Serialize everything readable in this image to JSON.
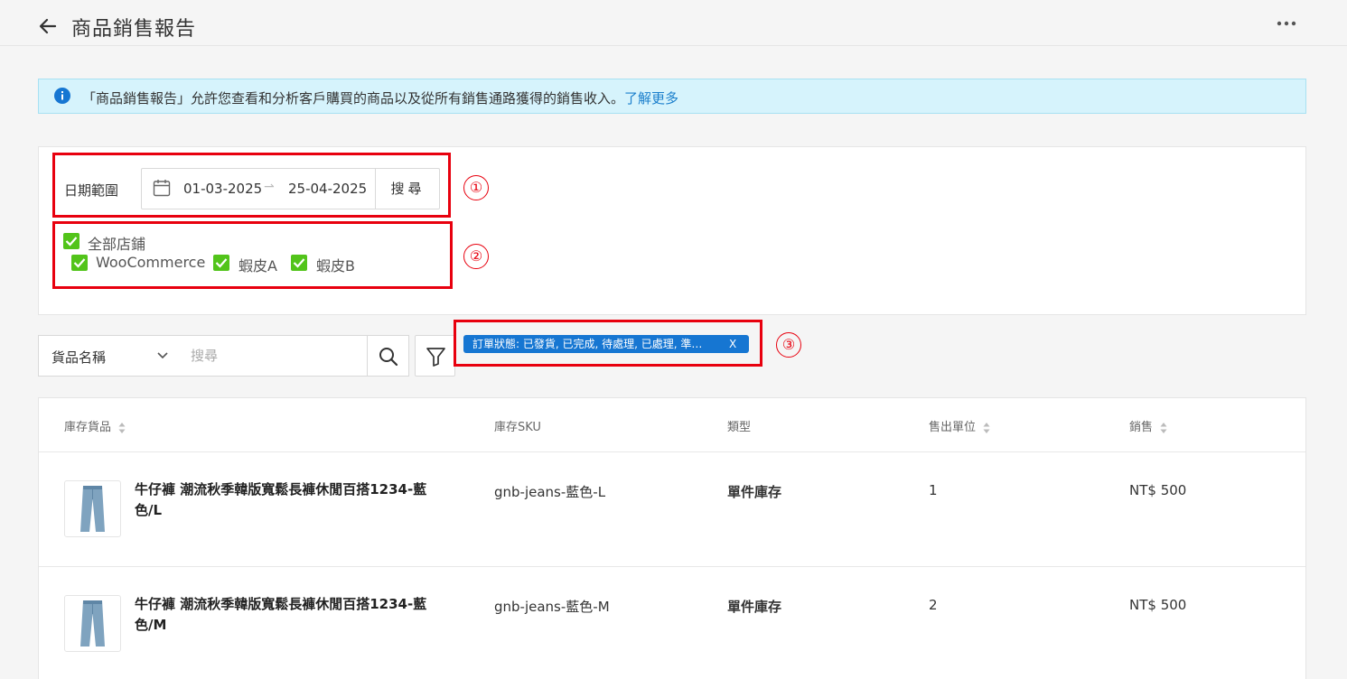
{
  "header": {
    "title": "商品銷售報告"
  },
  "banner": {
    "text": "「商品銷售報告」允許您查看和分析客戶購買的商品以及從所有銷售通路獲得的銷售收入。",
    "link": "了解更多"
  },
  "filters": {
    "date_label": "日期範圍",
    "date_start": "01-03-2025",
    "date_end": "25-04-2025",
    "search_button": "搜尋",
    "all_stores": "全部店鋪",
    "stores": [
      "WooCommerce",
      "蝦皮A",
      "蝦皮B"
    ]
  },
  "toolbar": {
    "field_select": "貨品名稱",
    "search_placeholder": "搜尋",
    "status_tag": "訂單狀態: 已發貨, 已完成, 待處理, 已處理, 準…",
    "tag_close": "X"
  },
  "callouts": [
    "①",
    "②",
    "③"
  ],
  "table": {
    "columns": [
      "庫存貨品",
      "庫存SKU",
      "類型",
      "售出單位",
      "銷售"
    ],
    "rows": [
      {
        "name": "牛仔褲 潮流秋季韓版寬鬆長褲休閒百搭1234-藍色/L",
        "sku": "gnb-jeans-藍色-L",
        "type": "單件庫存",
        "units": "1",
        "sales": "NT$ 500"
      },
      {
        "name": "牛仔褲 潮流秋季韓版寬鬆長褲休閒百搭1234-藍色/M",
        "sku": "gnb-jeans-藍色-M",
        "type": "單件庫存",
        "units": "2",
        "sales": "NT$ 500"
      }
    ]
  },
  "colors": {
    "accent": "#1676d2",
    "check": "#52c41a",
    "annotation": "#e8000e",
    "banner_bg": "#d6f3fc"
  }
}
